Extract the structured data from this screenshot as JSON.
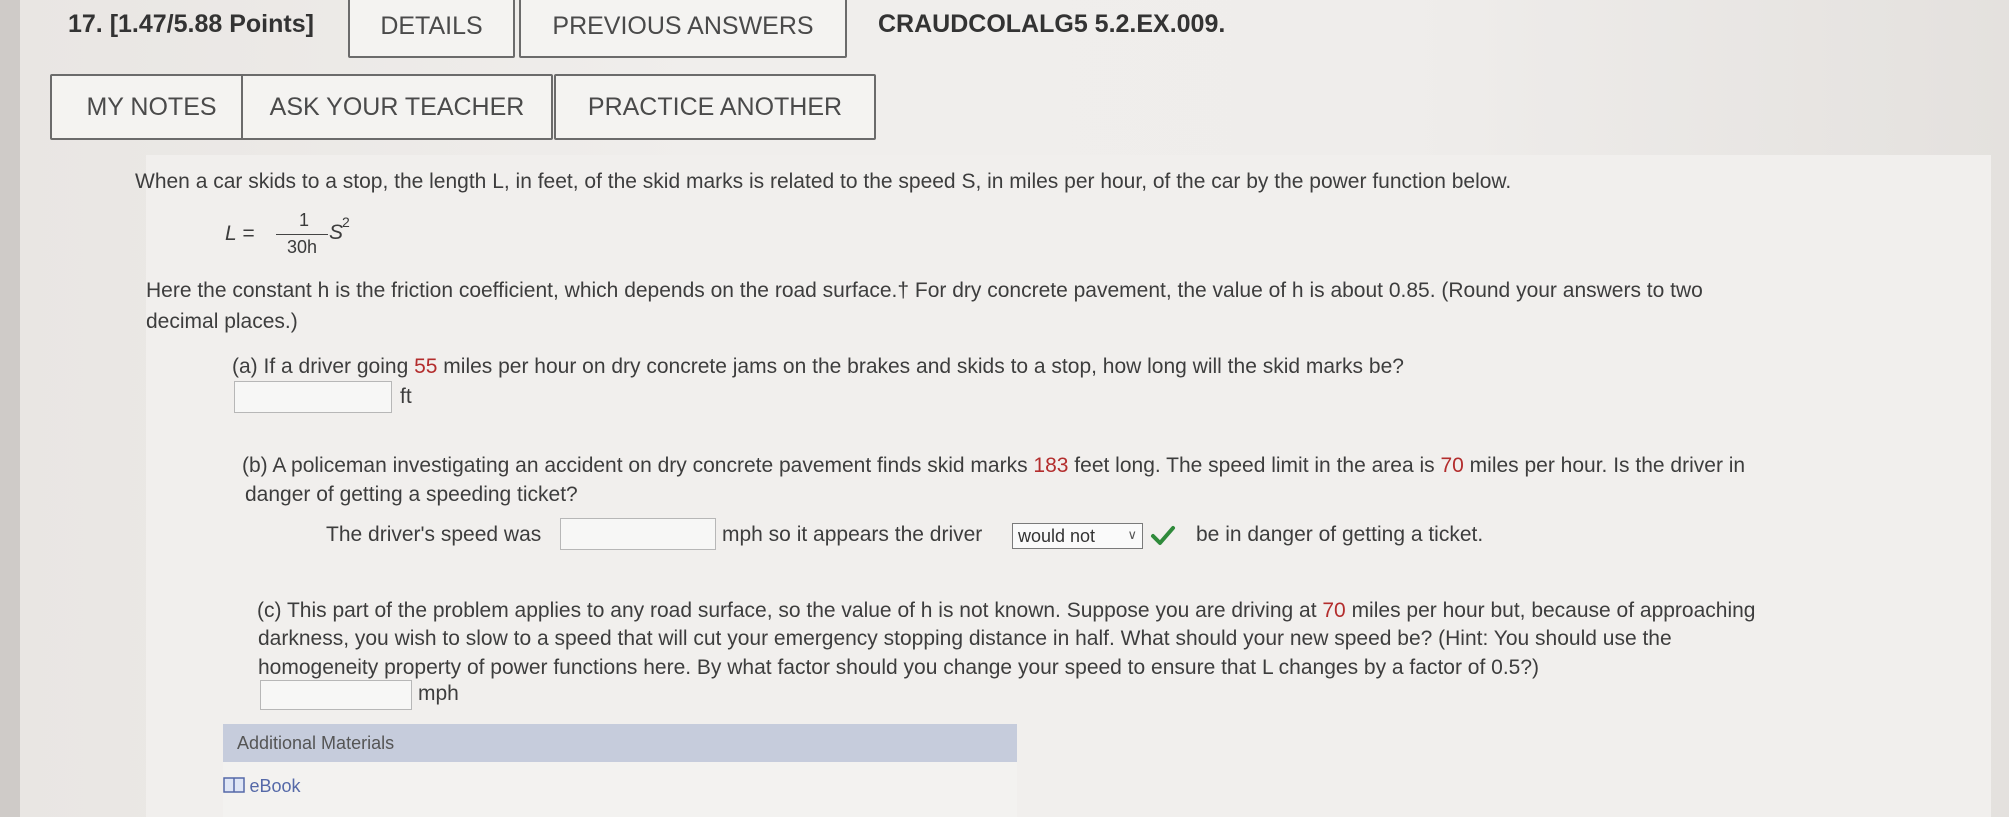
{
  "header": {
    "question": "17.  [1.47/5.88 Points]",
    "details_label": "DETAILS",
    "previous_answers_label": "PREVIOUS ANSWERS",
    "code": "CRAUDCOLALG5 5.2.EX.009."
  },
  "toolbar": {
    "my_notes_label": "MY NOTES",
    "ask_teacher_label": "ASK YOUR TEACHER",
    "practice_label": "PRACTICE ANOTHER"
  },
  "problem": {
    "intro": "When a car skids to a stop, the length L, in feet, of the skid marks is related to the speed S, in miles per hour, of the car by the power function below.",
    "formula_lhs": "L =",
    "formula_num": "1",
    "formula_den": "30h",
    "formula_var": "S",
    "formula_exp": "2",
    "constant_text": "Here the constant h is the friction coefficient, which depends on the road surface.† For dry concrete pavement, the value of h is about 0.85. (Round your answers to two",
    "constant_text_2": "decimal places.)",
    "part_a": {
      "q_pre": "(a) If a driver going ",
      "q_val": "55",
      "q_post": " miles per hour on dry concrete jams on the brakes and skids to a stop, how long will the skid marks be?",
      "unit": "ft",
      "answer": ""
    },
    "part_b": {
      "q_pre": "(b) A policeman investigating an accident on dry concrete pavement finds skid marks ",
      "q_val1": "183",
      "q_mid": " feet long. The speed limit in the area is ",
      "q_val2": "70",
      "q_post": " miles per hour. Is the driver in",
      "q_line2": "danger of getting a speeding ticket?",
      "speed_pre": "The driver's speed was",
      "speed_post": "mph so it appears the driver",
      "select_value": "would not",
      "after_select": "be in danger of getting a ticket.",
      "answer": ""
    },
    "part_c": {
      "q_pre": "(c) This part of the problem applies to any road surface, so the value of h is not known. Suppose you are driving at ",
      "q_val": "70",
      "q_post": " miles per hour but, because of approaching",
      "line2": "darkness, you wish to slow to a speed that will cut your emergency stopping distance in half. What should your new speed be? (Hint: You should use the",
      "line3": "homogeneity property of power functions here. By what factor should you change your speed to ensure that L changes by a factor of 0.5?)",
      "unit": "mph",
      "answer": ""
    }
  },
  "additional": {
    "title": "Additional Materials",
    "ebook_label": "eBook"
  },
  "icons": [
    "check-icon",
    "chevron-down-icon",
    "ebook-icon"
  ],
  "colors": {
    "highlight": "#b32d2d",
    "check": "#2f8a3b",
    "materials_bar": "#c6ccdc"
  }
}
